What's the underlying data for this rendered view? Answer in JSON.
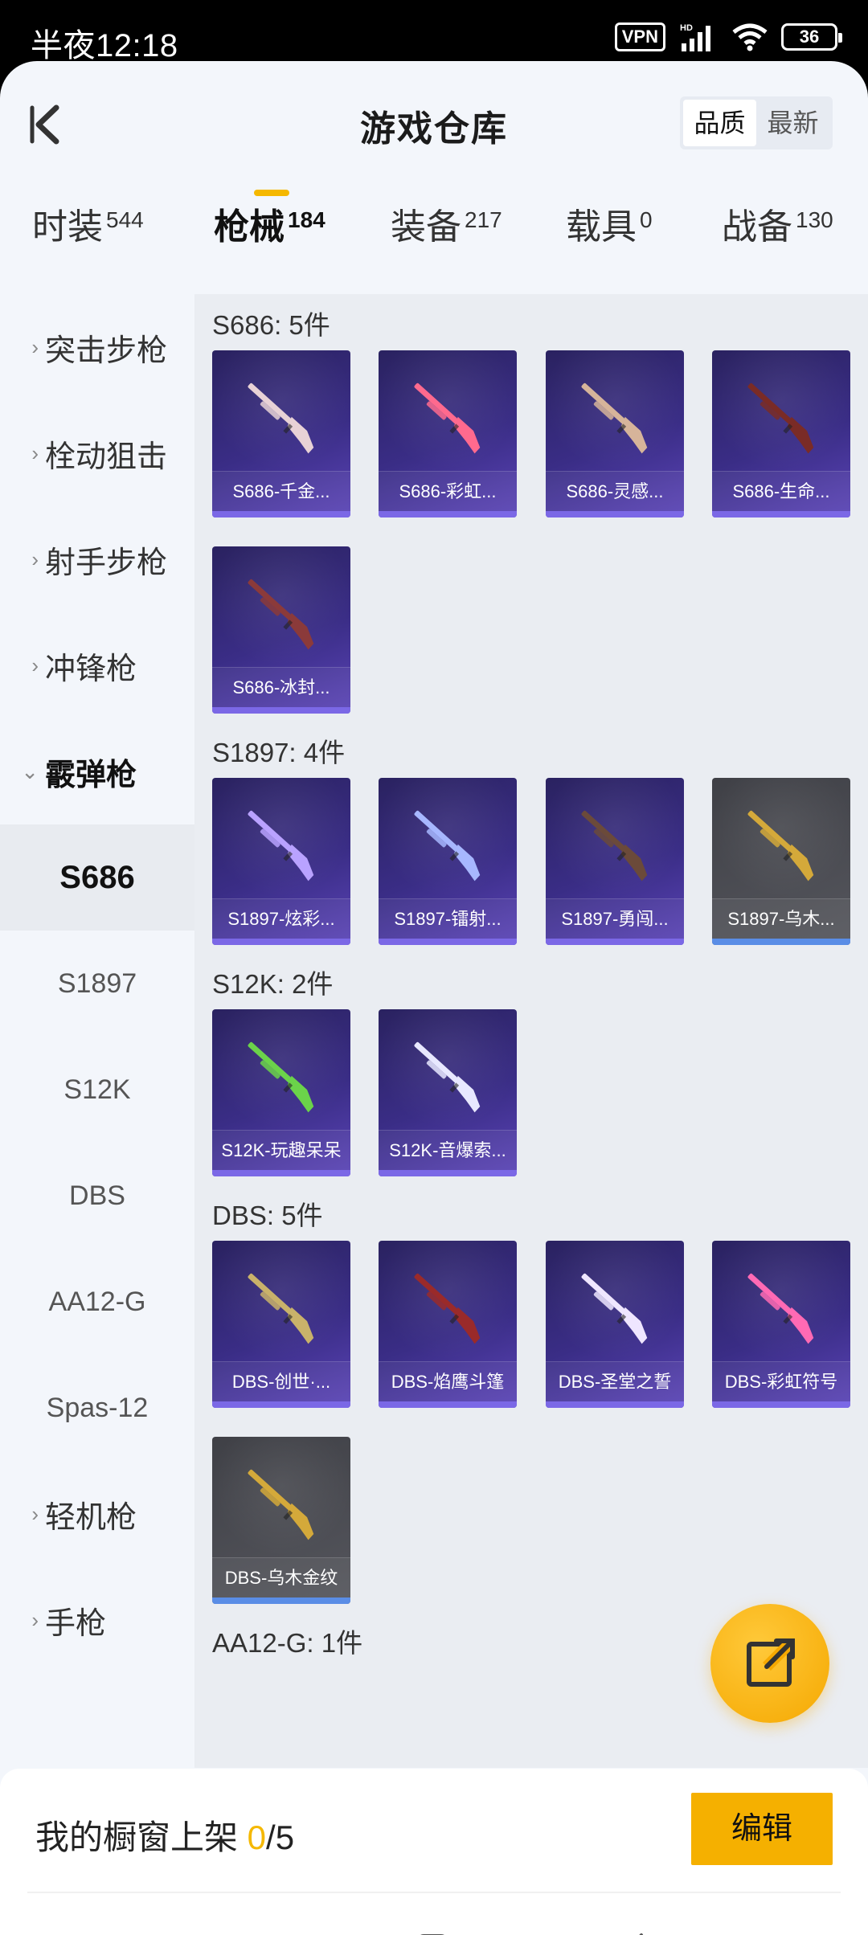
{
  "status_bar": {
    "time": "半夜12:18",
    "vpn": "VPN",
    "signal_label": "HD",
    "battery": "36"
  },
  "header": {
    "title": "游戏仓库",
    "sort_options": [
      "品质",
      "最新"
    ],
    "active_sort": "品质"
  },
  "tabs": [
    {
      "label": "时装",
      "count": "544"
    },
    {
      "label": "枪械",
      "count": "184"
    },
    {
      "label": "装备",
      "count": "217"
    },
    {
      "label": "载具",
      "count": "0"
    },
    {
      "label": "战备",
      "count": "130"
    }
  ],
  "active_tab": "枪械",
  "sidebar": {
    "categories": [
      {
        "label": "突击步枪",
        "expanded": false
      },
      {
        "label": "栓动狙击",
        "expanded": false
      },
      {
        "label": "射手步枪",
        "expanded": false
      },
      {
        "label": "冲锋枪",
        "expanded": false
      },
      {
        "label": "霰弹枪",
        "expanded": true
      },
      {
        "label": "轻机枪",
        "expanded": false
      },
      {
        "label": "手枪",
        "expanded": false
      }
    ],
    "subitems": [
      "S686",
      "S1897",
      "S12K",
      "DBS",
      "AA12-G",
      "Spas-12"
    ],
    "active_subitem": "S686"
  },
  "sections": [
    {
      "title": "S686: 5件",
      "items": [
        {
          "name": "S686-千金...",
          "rarity": "purple",
          "gun_color": "#e8d2d6"
        },
        {
          "name": "S686-彩虹...",
          "rarity": "purple",
          "gun_color": "#ff6a8e"
        },
        {
          "name": "S686-灵感...",
          "rarity": "purple",
          "gun_color": "#d6b49a"
        },
        {
          "name": "S686-生命...",
          "rarity": "purple",
          "gun_color": "#7a2b26"
        },
        {
          "name": "S686-冰封...",
          "rarity": "purple",
          "gun_color": "#8b3a3a"
        }
      ]
    },
    {
      "title": "S1897: 4件",
      "items": [
        {
          "name": "S1897-炫彩...",
          "rarity": "purple",
          "gun_color": "#b9a2ff"
        },
        {
          "name": "S1897-镭射...",
          "rarity": "purple",
          "gun_color": "#a7b7ff"
        },
        {
          "name": "S1897-勇闯...",
          "rarity": "purple",
          "gun_color": "#6b4a3a"
        },
        {
          "name": "S1897-乌木...",
          "rarity": "grey",
          "gun_color": "#d4a93a"
        }
      ]
    },
    {
      "title": "S12K: 2件",
      "items": [
        {
          "name": "S12K-玩趣呆呆",
          "rarity": "purple",
          "gun_color": "#6bd34a"
        },
        {
          "name": "S12K-音爆索...",
          "rarity": "purple",
          "gun_color": "#e8e8ff"
        }
      ]
    },
    {
      "title": "DBS: 5件",
      "items": [
        {
          "name": "DBS-创世·...",
          "rarity": "purple",
          "gun_color": "#c9b26a"
        },
        {
          "name": "DBS-焰鹰斗篷",
          "rarity": "purple",
          "gun_color": "#9a2a2a"
        },
        {
          "name": "DBS-圣堂之誓",
          "rarity": "purple",
          "gun_color": "#efe6ff"
        },
        {
          "name": "DBS-彩虹符号",
          "rarity": "purple",
          "gun_color": "#ff6ab4"
        },
        {
          "name": "DBS-乌木金纹",
          "rarity": "grey",
          "gun_color": "#d4a93a"
        }
      ]
    },
    {
      "title": "AA12-G: 1件",
      "items": []
    }
  ],
  "bottom": {
    "shelf_prefix": "我的橱窗上架 ",
    "shelf_count": "0",
    "shelf_total": "/5",
    "edit_label": "编辑"
  },
  "colors": {
    "accent": "#f5b000",
    "card_purple": "#3a2d86",
    "card_grey": "#55565d",
    "page_bg": "#f3f6fb"
  }
}
